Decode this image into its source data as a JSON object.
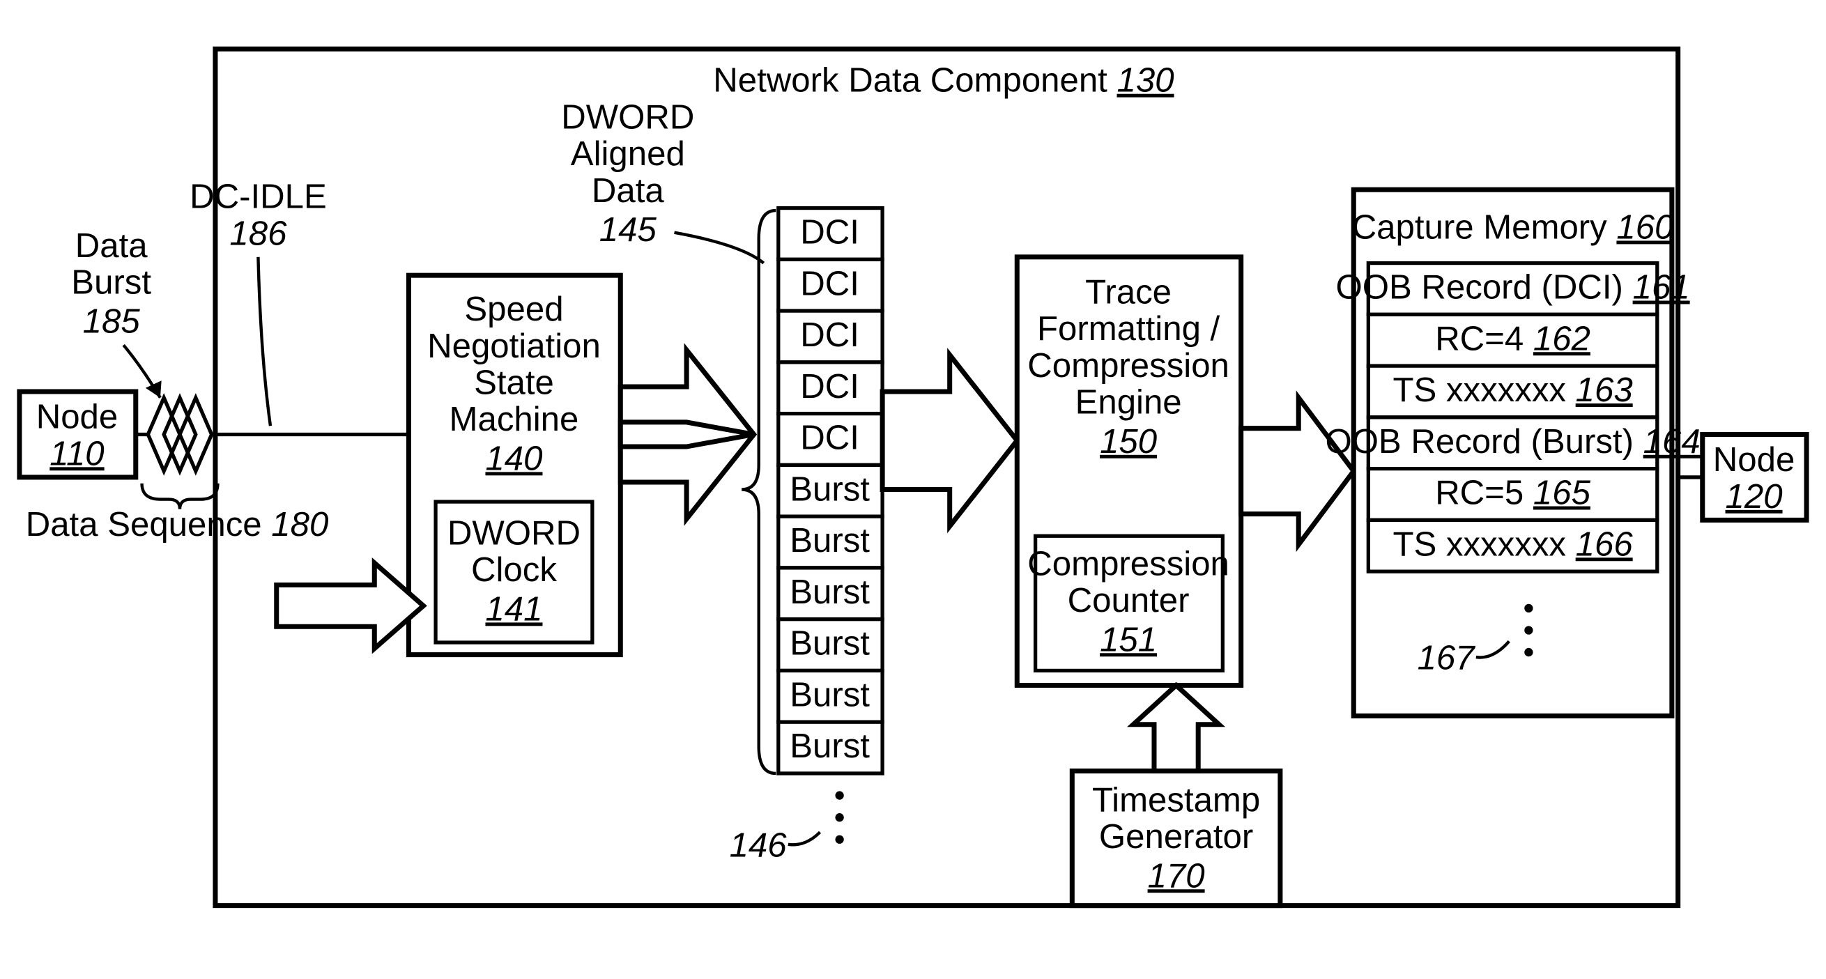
{
  "title": {
    "label": "Network Data Component",
    "ref": "130"
  },
  "node_left": {
    "label": "Node",
    "ref": "110"
  },
  "node_right": {
    "label": "Node",
    "ref": "120"
  },
  "data_burst": {
    "label1": "Data",
    "label2": "Burst",
    "ref": "185"
  },
  "dc_idle": {
    "label": "DC-IDLE",
    "ref": "186"
  },
  "data_sequence": {
    "label": "Data Sequence",
    "ref": "180"
  },
  "snsm": {
    "l1": "Speed",
    "l2": "Negotiation",
    "l3": "State",
    "l4": "Machine",
    "ref": "140",
    "clock": {
      "l1": "DWORD",
      "l2": "Clock",
      "ref": "141"
    }
  },
  "aligned": {
    "l1": "DWORD",
    "l2": "Aligned",
    "l3": "Data",
    "ref": "145",
    "rows": [
      "DCI",
      "DCI",
      "DCI",
      "DCI",
      "DCI",
      "Burst",
      "Burst",
      "Burst",
      "Burst",
      "Burst",
      "Burst"
    ],
    "ell_ref": "146"
  },
  "engine": {
    "l1": "Trace",
    "l2": "Formatting /",
    "l3": "Compression",
    "l4": "Engine",
    "ref": "150",
    "counter": {
      "l1": "Compression",
      "l2": "Counter",
      "ref": "151"
    }
  },
  "tsgen": {
    "l1": "Timestamp",
    "l2": "Generator",
    "ref": "170"
  },
  "capture": {
    "label": "Capture Memory",
    "ref": "160",
    "rows": [
      {
        "label": "OOB Record (DCI)",
        "ref": "161"
      },
      {
        "label": "RC=4",
        "ref": "162"
      },
      {
        "label": "TS xxxxxxx",
        "ref": "163"
      },
      {
        "label": "OOB Record (Burst)",
        "ref": "164"
      },
      {
        "label": "RC=5",
        "ref": "165"
      },
      {
        "label": "TS xxxxxxx",
        "ref": "166"
      }
    ],
    "ell_ref": "167"
  }
}
